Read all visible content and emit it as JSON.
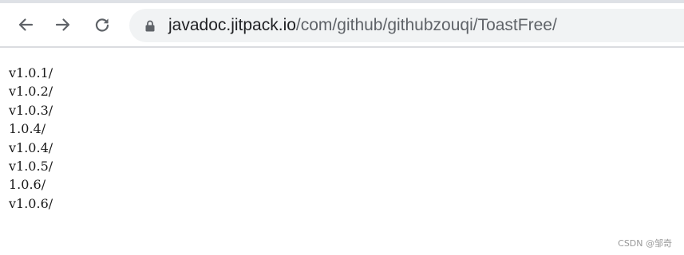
{
  "browser": {
    "icons": {
      "back": "back-arrow-icon",
      "forward": "forward-arrow-icon",
      "reload": "reload-icon",
      "lock": "lock-icon"
    },
    "url_host": "javadoc.jitpack.io",
    "url_path": "/com/github/githubzouqi/ToastFree/"
  },
  "listing": [
    "v1.0.1/",
    "v1.0.2/",
    "v1.0.3/",
    "1.0.4/",
    "v1.0.4/",
    "v1.0.5/",
    "1.0.6/",
    "v1.0.6/"
  ],
  "watermark": "CSDN @邹奇",
  "colors": {
    "toolbar_bg": "#ffffff",
    "omnibox_bg": "#f1f3f4",
    "icon": "#5f6368",
    "url_host": "#202124",
    "url_path": "#5f6368",
    "text": "#1a1a1a"
  }
}
